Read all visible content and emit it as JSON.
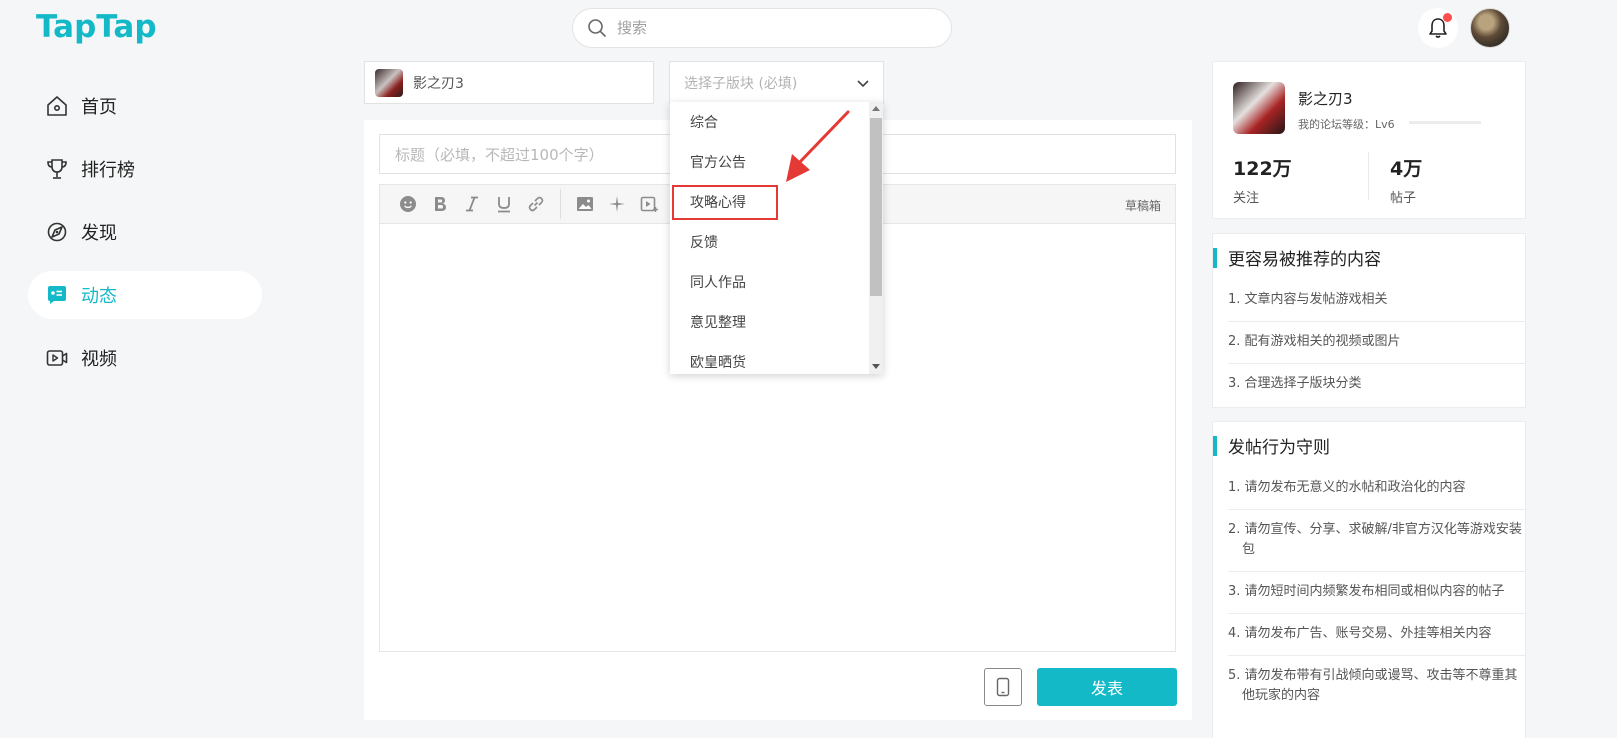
{
  "header": {
    "logo_text": "TapTap",
    "search_placeholder": "搜索"
  },
  "nav": {
    "items": [
      {
        "label": "首页",
        "icon": "home-icon"
      },
      {
        "label": "排行榜",
        "icon": "trophy-icon"
      },
      {
        "label": "发现",
        "icon": "discover-icon"
      },
      {
        "label": "动态",
        "icon": "feed-icon",
        "active": true
      },
      {
        "label": "视频",
        "icon": "video-icon"
      }
    ]
  },
  "composer": {
    "game_name": "影之刃3",
    "subforum_placeholder": "选择子版块 (必填)",
    "title_placeholder": "标题（必填，不超过100个字）",
    "draft_label": "草稿箱",
    "publish_label": "发表"
  },
  "dropdown": {
    "options": [
      "综合",
      "官方公告",
      "攻略心得",
      "反馈",
      "同人作品",
      "意见整理",
      "欧皇晒货"
    ],
    "highlighted": "攻略心得"
  },
  "game_card": {
    "name": "影之刃3",
    "level_text": "我的论坛等级：Lv6",
    "followers_value": "122万",
    "followers_label": "关注",
    "posts_value": "4万",
    "posts_label": "帖子"
  },
  "recommend": {
    "title": "更容易被推荐的内容",
    "items": [
      "1. 文章内容与发帖游戏相关",
      "2. 配有游戏相关的视频或图片",
      "3. 合理选择子版块分类"
    ]
  },
  "rules": {
    "title": "发帖行为守则",
    "items": [
      "1. 请勿发布无意义的水帖和政治化的内容",
      "2. 请勿宣传、分享、求破解/非官方汉化等游戏安装包",
      "3. 请勿短时间内频繁发布相同或相似内容的帖子",
      "4. 请勿发布广告、账号交易、外挂等相关内容",
      "5. 请勿发布带有引战倾向或谩骂、攻击等不尊重其他玩家的内容"
    ]
  },
  "colors": {
    "accent": "#14b9c8",
    "highlight_border": "#e53935",
    "notification_dot": "#ff4d4f"
  }
}
